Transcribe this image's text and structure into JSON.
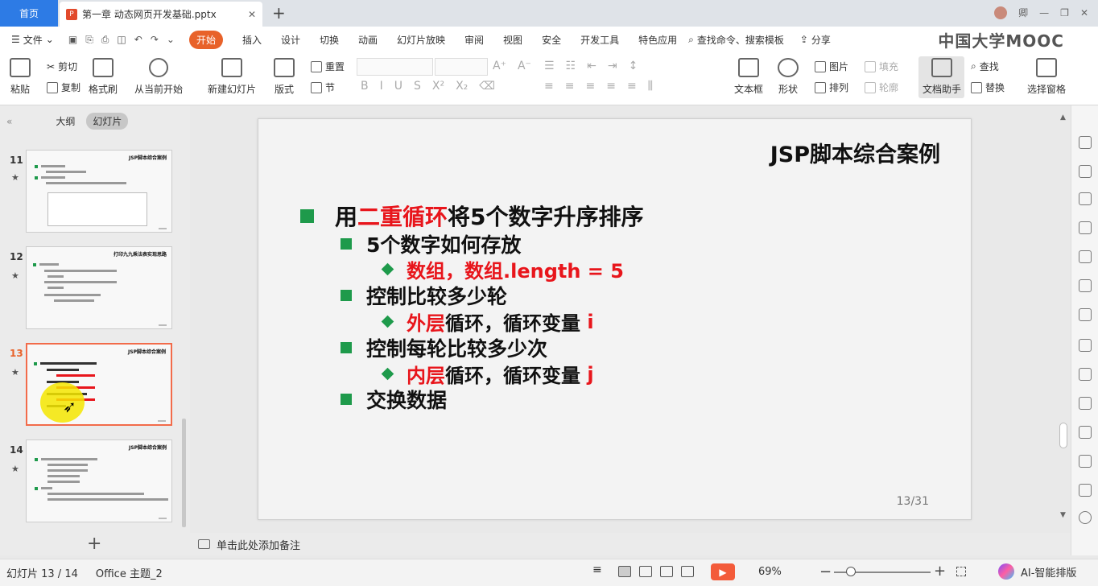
{
  "tabs": {
    "home": "首页",
    "document": "第一章 动态网页开发基础.pptx",
    "close": "✕",
    "new": "+"
  },
  "window": {
    "user": "卿"
  },
  "menu": {
    "file": "文件",
    "items": [
      "开始",
      "插入",
      "设计",
      "切换",
      "动画",
      "幻灯片放映",
      "审阅",
      "视图",
      "安全",
      "开发工具",
      "特色应用"
    ],
    "search": "查找命令、搜索模板",
    "share": "分享"
  },
  "watermark": "中国大学MOOC",
  "ribbon": {
    "paste": "粘贴",
    "cut": "剪切",
    "copy": "复制",
    "format_painter": "格式刷",
    "from_current": "从当前开始",
    "new_slide": "新建幻灯片",
    "layout": "版式",
    "reset": "重置",
    "section": "节",
    "textbox": "文本框",
    "shape": "形状",
    "picture": "图片",
    "arrange": "排列",
    "fill": "填充",
    "outline": "轮廓",
    "doc_helper": "文档助手",
    "find": "查找",
    "replace": "替换",
    "select_pane": "选择窗格"
  },
  "panel": {
    "outline_tab": "大纲",
    "slides_tab": "幻灯片",
    "collapse": "«",
    "add": "+"
  },
  "thumbnails": [
    {
      "num": "11",
      "title": "JSP脚本综合案例"
    },
    {
      "num": "12",
      "title": "打印九九乘法表实现思路"
    },
    {
      "num": "13",
      "title": "JSP脚本综合案例"
    },
    {
      "num": "14",
      "title": "JSP脚本综合案例"
    }
  ],
  "slide": {
    "title": "JSP脚本综合案例",
    "l1_prefix": "用",
    "l1_red": "二重循环",
    "l1_suffix": "将5个数字升序排序",
    "b1": "5个数字如何存放",
    "b1_sub": "数组，数组.length = 5",
    "b2": "控制比较多少轮",
    "b2_sub_red": "外层",
    "b2_sub_mid": "循环，循环变量 ",
    "b2_sub_var": "i",
    "b3": "控制每轮比较多少次",
    "b3_sub_red": "内层",
    "b3_sub_mid": "循环，循环变量 ",
    "b3_sub_var": "j",
    "b4": "交换数据",
    "page": "13/31"
  },
  "notes": {
    "placeholder": "单击此处添加备注"
  },
  "status": {
    "slides": "幻灯片 13 / 14",
    "theme": "Office 主题_2",
    "zoom": "69%",
    "zoom_level_percent": 69,
    "ai": "AI-智能排版"
  },
  "colors": {
    "accent": "#e8622a",
    "bullet": "#1e9a4b",
    "red": "#e8151b",
    "home_tab": "#2d7be5"
  }
}
